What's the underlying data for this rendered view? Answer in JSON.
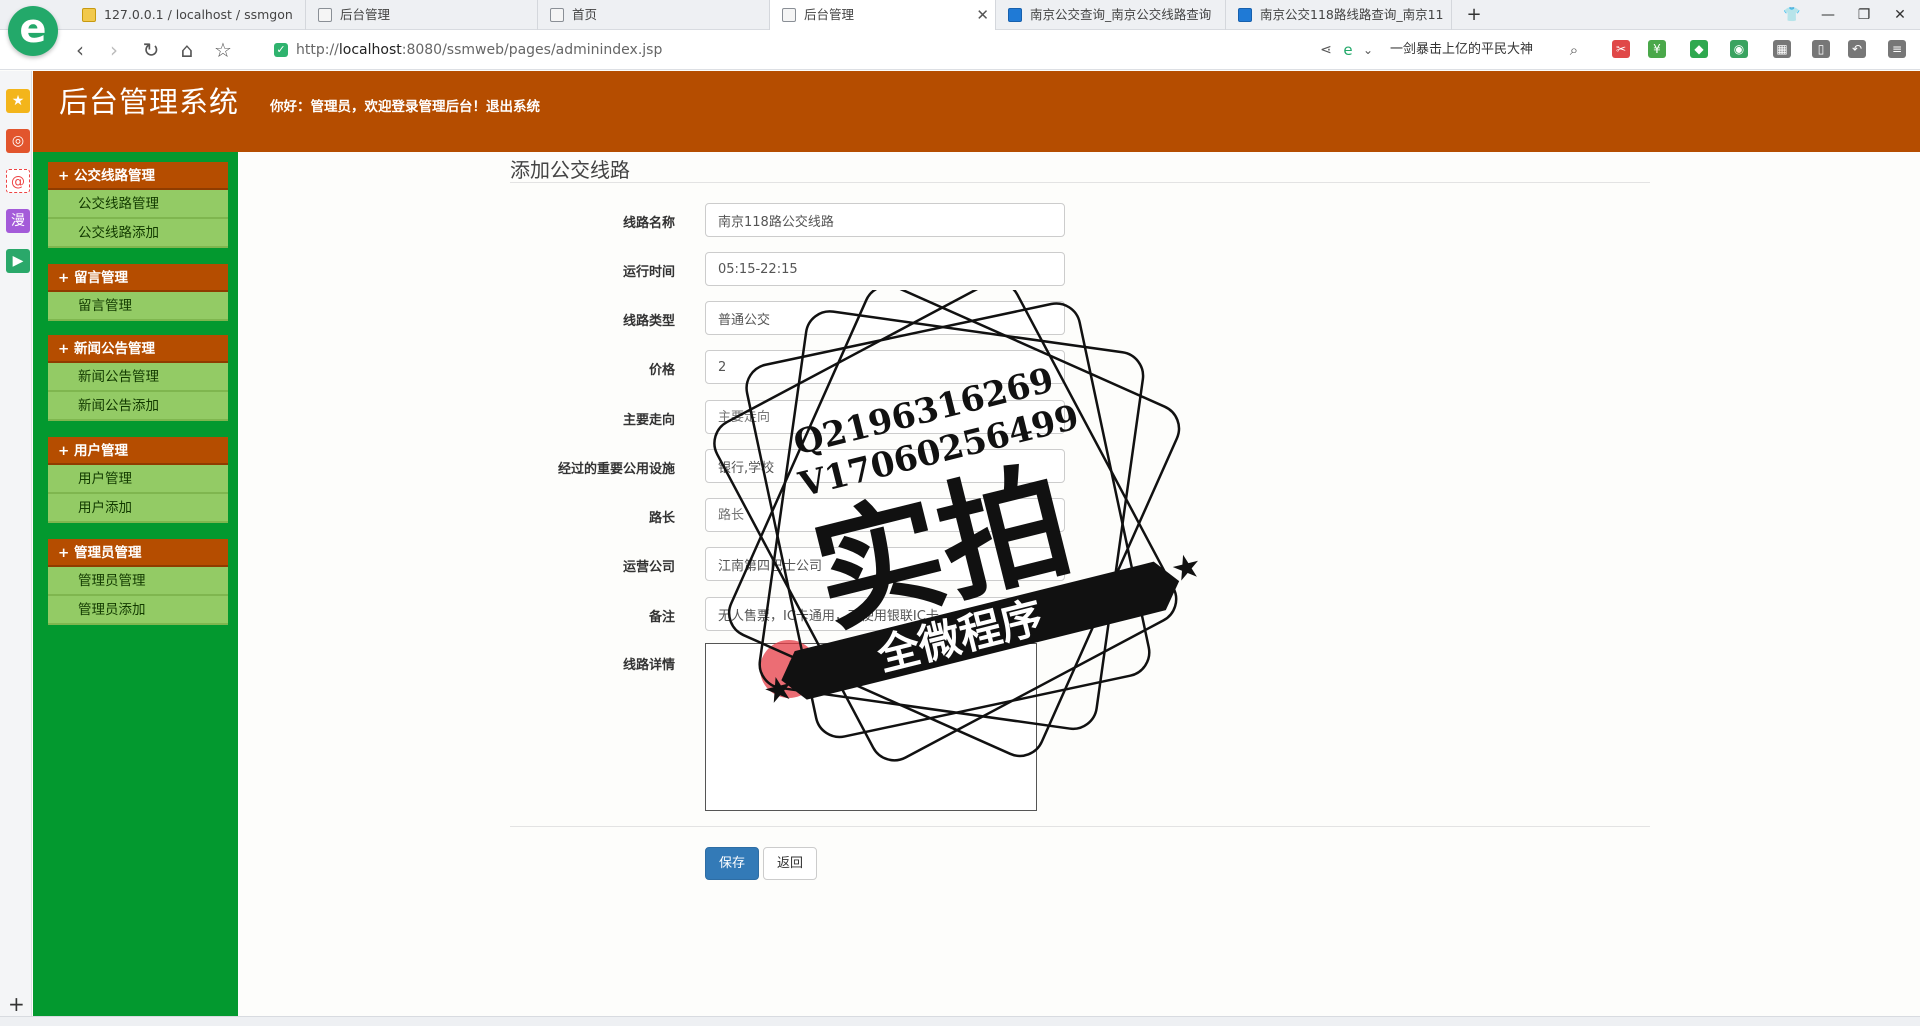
{
  "browser": {
    "tabs": [
      {
        "label": "127.0.0.1 / localhost / ssmgon",
        "icon": "pma-favicon"
      },
      {
        "label": "后台管理",
        "icon": "page-favicon"
      },
      {
        "label": "首页",
        "icon": "page-favicon"
      },
      {
        "label": "后台管理",
        "icon": "page-favicon",
        "active": true
      },
      {
        "label": "南京公交查询_南京公交线路查询",
        "icon": "bus-favicon"
      },
      {
        "label": "南京公交118路线路查询_南京11",
        "icon": "bus-favicon"
      }
    ],
    "new_tab": "+",
    "url_scheme": "http://",
    "url_host": "localhost",
    "url_path": ":8080/ssmweb/pages/adminindex.jsp",
    "search_text": "一剑暴击上亿的平民大神"
  },
  "header": {
    "title": "后台管理系统",
    "welcome": "你好：管理员，欢迎登录管理后台！",
    "logout": "退出系统"
  },
  "sidebar": {
    "groups": [
      {
        "title": "+ 公交线路管理",
        "items": [
          "公交线路管理",
          "公交线路添加"
        ]
      },
      {
        "title": "+ 留言管理",
        "items": [
          "留言管理"
        ]
      },
      {
        "title": "+ 新闻公告管理",
        "items": [
          "新闻公告管理",
          "新闻公告添加"
        ]
      },
      {
        "title": "+ 用户管理",
        "items": [
          "用户管理",
          "用户添加"
        ]
      },
      {
        "title": "+ 管理员管理",
        "items": [
          "管理员管理",
          "管理员添加"
        ]
      }
    ]
  },
  "form": {
    "title": "添加公交线路",
    "fields": [
      {
        "label": "线路名称",
        "value": "南京118路公交线路"
      },
      {
        "label": "运行时间",
        "value": "05:15-22:15"
      },
      {
        "label": "线路类型",
        "value": "普通公交"
      },
      {
        "label": "价格",
        "value": "2"
      },
      {
        "label": "主要走向",
        "placeholder": "主要走向"
      },
      {
        "label": "经过的重要公用设施",
        "value": "银行,学校"
      },
      {
        "label": "路长",
        "placeholder": "路长"
      },
      {
        "label": "运营公司",
        "value": "江南第四巴士公司"
      },
      {
        "label": "备注",
        "value": "无人售票，IC卡通用，可使用银联IC卡"
      }
    ],
    "detail_label": "线路详情",
    "save": "保存",
    "back": "返回"
  },
  "watermark": {
    "line1": "Q2196316269",
    "line2": "V17060256499",
    "big": "实拍",
    "banner": "全微程序"
  }
}
